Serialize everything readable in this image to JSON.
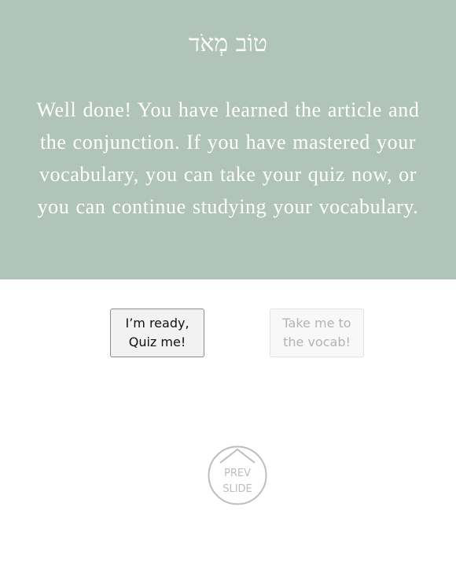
{
  "banner": {
    "hebrew_title": "טוֹב מְאֹד",
    "message_lines": [
      "Well done!  You have learned the article and",
      "the conjunction. If you have mastered your",
      "vocabulary, you can take your quiz now, or",
      "you can continue studying your vocabulary."
    ]
  },
  "buttons": {
    "quiz": {
      "line1": "I’m ready,",
      "line2": "Quiz me!"
    },
    "vocab": {
      "line1": "Take me to",
      "line2": "the vocab!"
    }
  },
  "navigation": {
    "prev_line1": "PREV",
    "prev_line2": "SLIDE",
    "icon": "up-arrow-icon"
  },
  "colors": {
    "banner_background": "#b1c4ba",
    "banner_text": "#ffffff",
    "quiz_border": "#8a8a8a",
    "vocab_text": "#b3b3b3",
    "prev_slide": "#bdbdbd"
  }
}
